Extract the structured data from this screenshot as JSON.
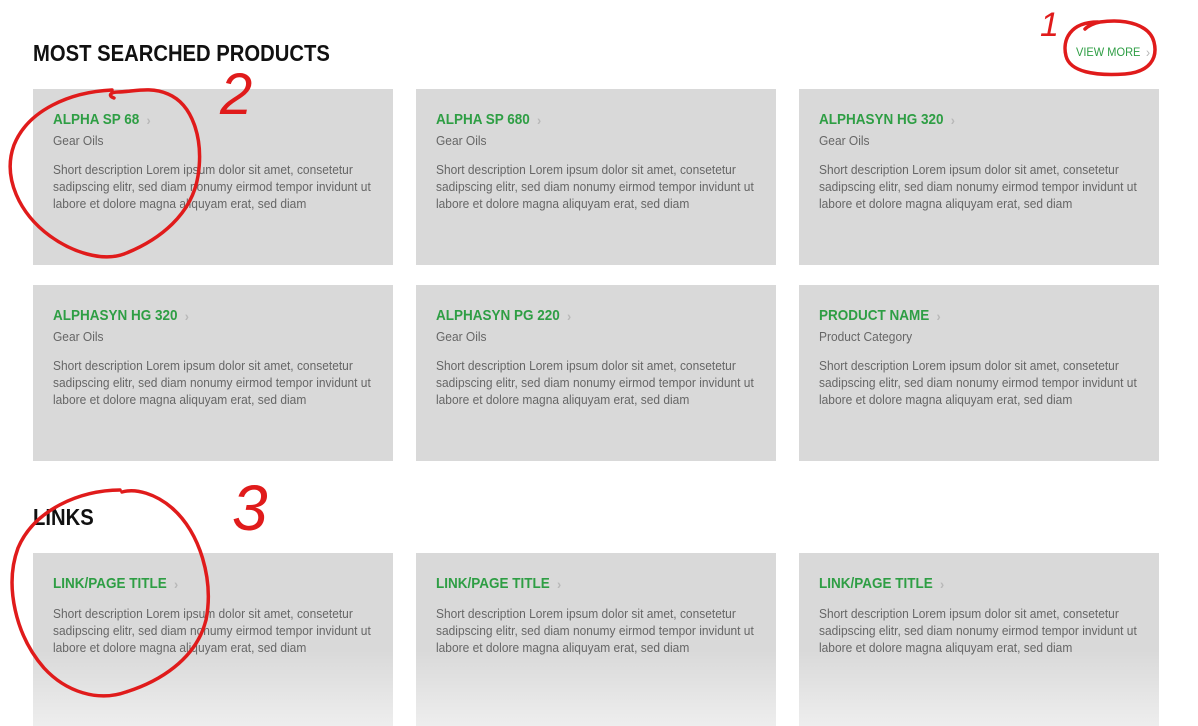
{
  "sections": {
    "products": {
      "title": "MOST SEARCHED PRODUCTS",
      "view_more": "VIEW MORE",
      "items": [
        {
          "name": "ALPHA SP 68",
          "category": "Gear Oils",
          "description": "Short description Lorem ipsum dolor sit amet, consetetur sadipscing elitr, sed diam nonumy eirmod tempor invidunt ut labore et dolore magna aliquyam erat, sed diam"
        },
        {
          "name": "ALPHA SP 680",
          "category": "Gear Oils",
          "description": "Short description Lorem ipsum dolor sit amet, consetetur sadipscing elitr, sed diam nonumy eirmod tempor invidunt ut labore et dolore magna aliquyam erat, sed diam"
        },
        {
          "name": "ALPHASYN HG 320",
          "category": "Gear Oils",
          "description": "Short description Lorem ipsum dolor sit amet, consetetur sadipscing elitr, sed diam nonumy eirmod tempor invidunt ut labore et dolore magna aliquyam erat, sed diam"
        },
        {
          "name": "ALPHASYN HG 320",
          "category": "Gear Oils",
          "description": "Short description Lorem ipsum dolor sit amet, consetetur sadipscing elitr, sed diam nonumy eirmod tempor invidunt ut labore et dolore magna aliquyam erat, sed diam"
        },
        {
          "name": "ALPHASYN PG 220",
          "category": "Gear Oils",
          "description": "Short description Lorem ipsum dolor sit amet, consetetur sadipscing elitr, sed diam nonumy eirmod tempor invidunt ut labore et dolore magna aliquyam erat, sed diam"
        },
        {
          "name": "PRODUCT NAME",
          "category": "Product Category",
          "description": "Short description Lorem ipsum dolor sit amet, consetetur sadipscing elitr, sed diam nonumy eirmod tempor invidunt ut labore et dolore magna aliquyam erat, sed diam"
        }
      ]
    },
    "links": {
      "title": "LINKS",
      "items": [
        {
          "title": "LINK/PAGE TITLE",
          "description": "Short description Lorem ipsum dolor sit amet, consetetur sadipscing elitr, sed diam nonumy eirmod tempor invidunt ut labore et dolore magna aliquyam erat, sed diam"
        },
        {
          "title": "LINK/PAGE TITLE",
          "description": "Short description Lorem ipsum dolor sit amet, consetetur sadipscing elitr, sed diam nonumy eirmod tempor invidunt ut labore et dolore magna aliquyam erat, sed diam"
        },
        {
          "title": "LINK/PAGE TITLE",
          "description": "Short description Lorem ipsum dolor sit amet, consetetur sadipscing elitr, sed diam nonumy eirmod tempor invidunt ut labore et dolore magna aliquyam erat, sed diam"
        }
      ]
    }
  },
  "annotations": {
    "numbers": [
      "1",
      "2",
      "3"
    ],
    "color": "#e01b1b"
  },
  "colors": {
    "accent": "#2e9e44",
    "card_bg": "#d9d9d9",
    "text_muted": "#666666",
    "heading": "#111111"
  },
  "icons": {
    "chevron": "chevron-right-icon"
  }
}
